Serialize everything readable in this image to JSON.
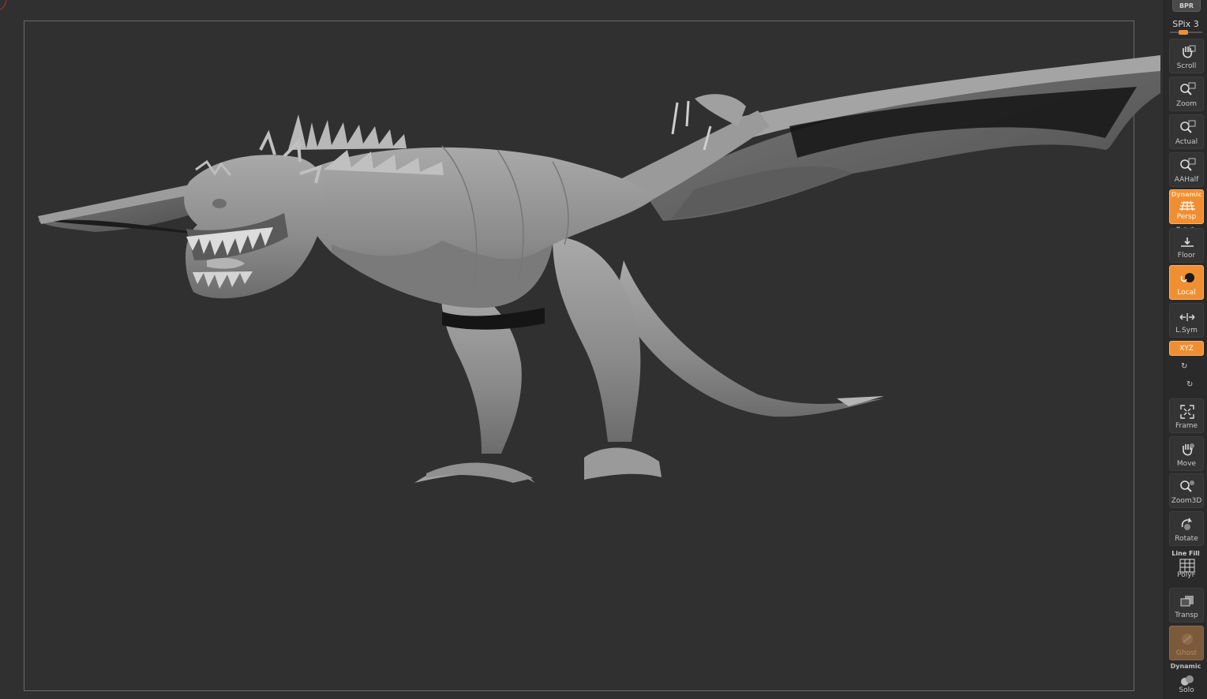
{
  "shelf": {
    "bpr_label": "BPR",
    "spix_label": "SPix 3",
    "spix_value": 3,
    "buttons": {
      "scroll": "Scroll",
      "zoom": "Zoom",
      "actual": "Actual",
      "aahalf": "AAHalf",
      "persp_top": "Dynamic",
      "persp": "Persp",
      "floor": "Floor",
      "local": "Local",
      "lsym": "L.Sym",
      "xyz": "XYZ",
      "frame": "Frame",
      "move": "Move",
      "zoom3d": "Zoom3D",
      "rotate": "Rotate",
      "linefill_top": "Line Fill",
      "polyf": "PolyF",
      "transp": "Transp",
      "ghost": "Ghost",
      "solo_top": "Dynamic",
      "solo": "Solo"
    },
    "active": [
      "Persp",
      "Local",
      "XYZ"
    ],
    "dim_active": [
      "Ghost"
    ]
  },
  "icons": {
    "scroll": "hand-icon",
    "zoom": "magnifier-icon",
    "actual": "magnifier-icon",
    "aahalf": "magnifier-icon",
    "persp": "perspective-grid-icon",
    "floor": "floor-icon",
    "local": "local-sphere-icon",
    "lsym": "symmetry-arrows-icon",
    "frame": "frame-icon",
    "move": "hand-icon",
    "zoom3d": "magnifier-icon",
    "rotate": "rotate-icon",
    "polyf": "polygon-grid-icon",
    "transp": "transparency-icon",
    "ghost": "ghost-icon",
    "solo": "solo-spheres-icon"
  },
  "colors": {
    "accent": "#f08f32",
    "viewport_bg": "#303030",
    "model": "#8f8f8f"
  },
  "canvas": {
    "content": "3d-dragon-sculpt"
  }
}
